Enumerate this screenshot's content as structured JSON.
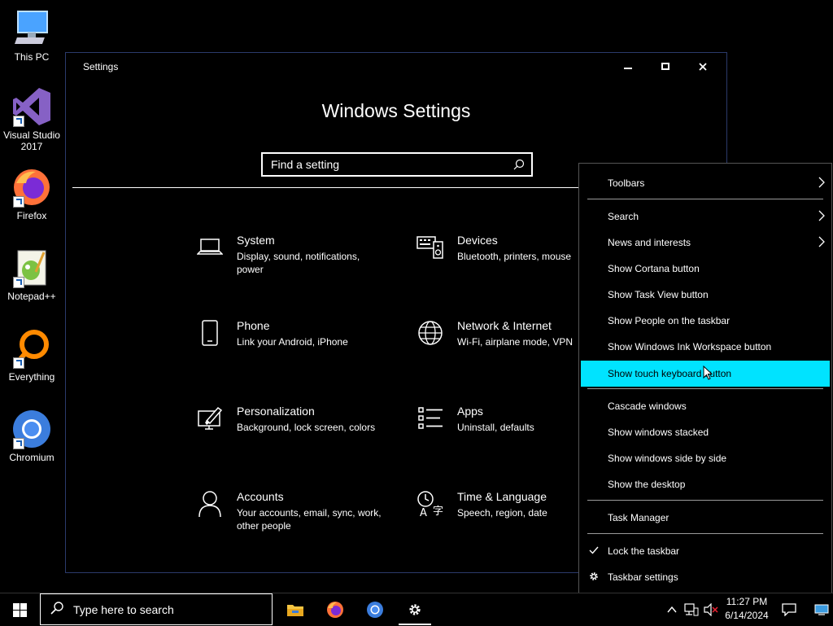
{
  "desktop": {
    "icons": [
      {
        "label": "This PC"
      },
      {
        "label": "Visual Studio 2017"
      },
      {
        "label": "Firefox"
      },
      {
        "label": "Notepad++"
      },
      {
        "label": "Everything"
      },
      {
        "label": "Chromium"
      }
    ]
  },
  "settings": {
    "window_title": "Settings",
    "headline": "Windows Settings",
    "search_placeholder": "Find a setting",
    "tiles": [
      {
        "name": "System",
        "desc": "Display, sound, notifications, power",
        "icon": "laptop-icon"
      },
      {
        "name": "Devices",
        "desc": "Bluetooth, printers, mouse",
        "icon": "keyboard-speaker-icon"
      },
      {
        "name": "Phone",
        "desc": "Link your Android, iPhone",
        "icon": "phone-icon"
      },
      {
        "name": "Network & Internet",
        "desc": "Wi-Fi, airplane mode, VPN",
        "icon": "globe-icon"
      },
      {
        "name": "Personalization",
        "desc": "Background, lock screen, colors",
        "icon": "paint-monitor-icon"
      },
      {
        "name": "Apps",
        "desc": "Uninstall, defaults",
        "icon": "apps-list-icon"
      },
      {
        "name": "Accounts",
        "desc": "Your accounts, email, sync, work, other people",
        "icon": "person-icon"
      },
      {
        "name": "Time & Language",
        "desc": "Speech, region, date",
        "icon": "time-language-icon"
      }
    ]
  },
  "context_menu": {
    "items": [
      {
        "label": "Toolbars",
        "submenu": true
      },
      {
        "label": "Search",
        "submenu": true
      },
      {
        "label": "News and interests",
        "submenu": true
      },
      {
        "label": "Show Cortana button"
      },
      {
        "label": "Show Task View button"
      },
      {
        "label": "Show People on the taskbar"
      },
      {
        "label": "Show Windows Ink Workspace button"
      },
      {
        "label": "Show touch keyboard button",
        "highlighted": true
      },
      {
        "label": "Cascade windows"
      },
      {
        "label": "Show windows stacked"
      },
      {
        "label": "Show windows side by side"
      },
      {
        "label": "Show the desktop"
      },
      {
        "label": "Task Manager"
      },
      {
        "label": "Lock the taskbar",
        "checked": true
      },
      {
        "label": "Taskbar settings",
        "icon": "gear-icon"
      }
    ],
    "highlight_color": "#00e3ff"
  },
  "taskbar": {
    "search_placeholder": "Type here to search",
    "clock_time": "11:27 PM",
    "clock_date": "6/14/2024"
  }
}
